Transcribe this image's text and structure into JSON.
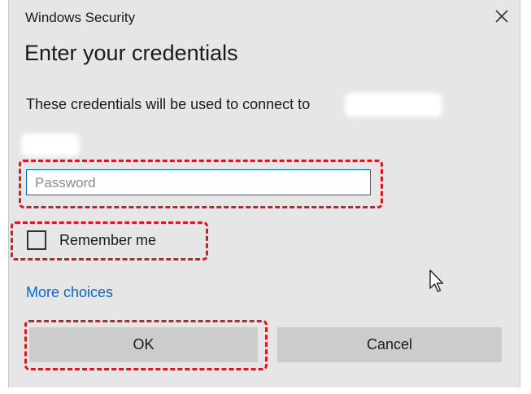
{
  "window": {
    "title": "Windows Security",
    "close_icon": "close-icon"
  },
  "content": {
    "heading": "Enter your credentials",
    "description": "These credentials will be used to connect to"
  },
  "password_field": {
    "placeholder": "Password",
    "value": ""
  },
  "remember": {
    "label": "Remember me",
    "checked": false
  },
  "links": {
    "more_choices": "More choices"
  },
  "buttons": {
    "ok": "OK",
    "cancel": "Cancel"
  },
  "colors": {
    "dialog_background": "#e6e6e6",
    "accent_link": "#0a66c8",
    "input_border": "#0067c0",
    "highlight_dash": "#d9181f",
    "button_background": "#cccccc"
  }
}
